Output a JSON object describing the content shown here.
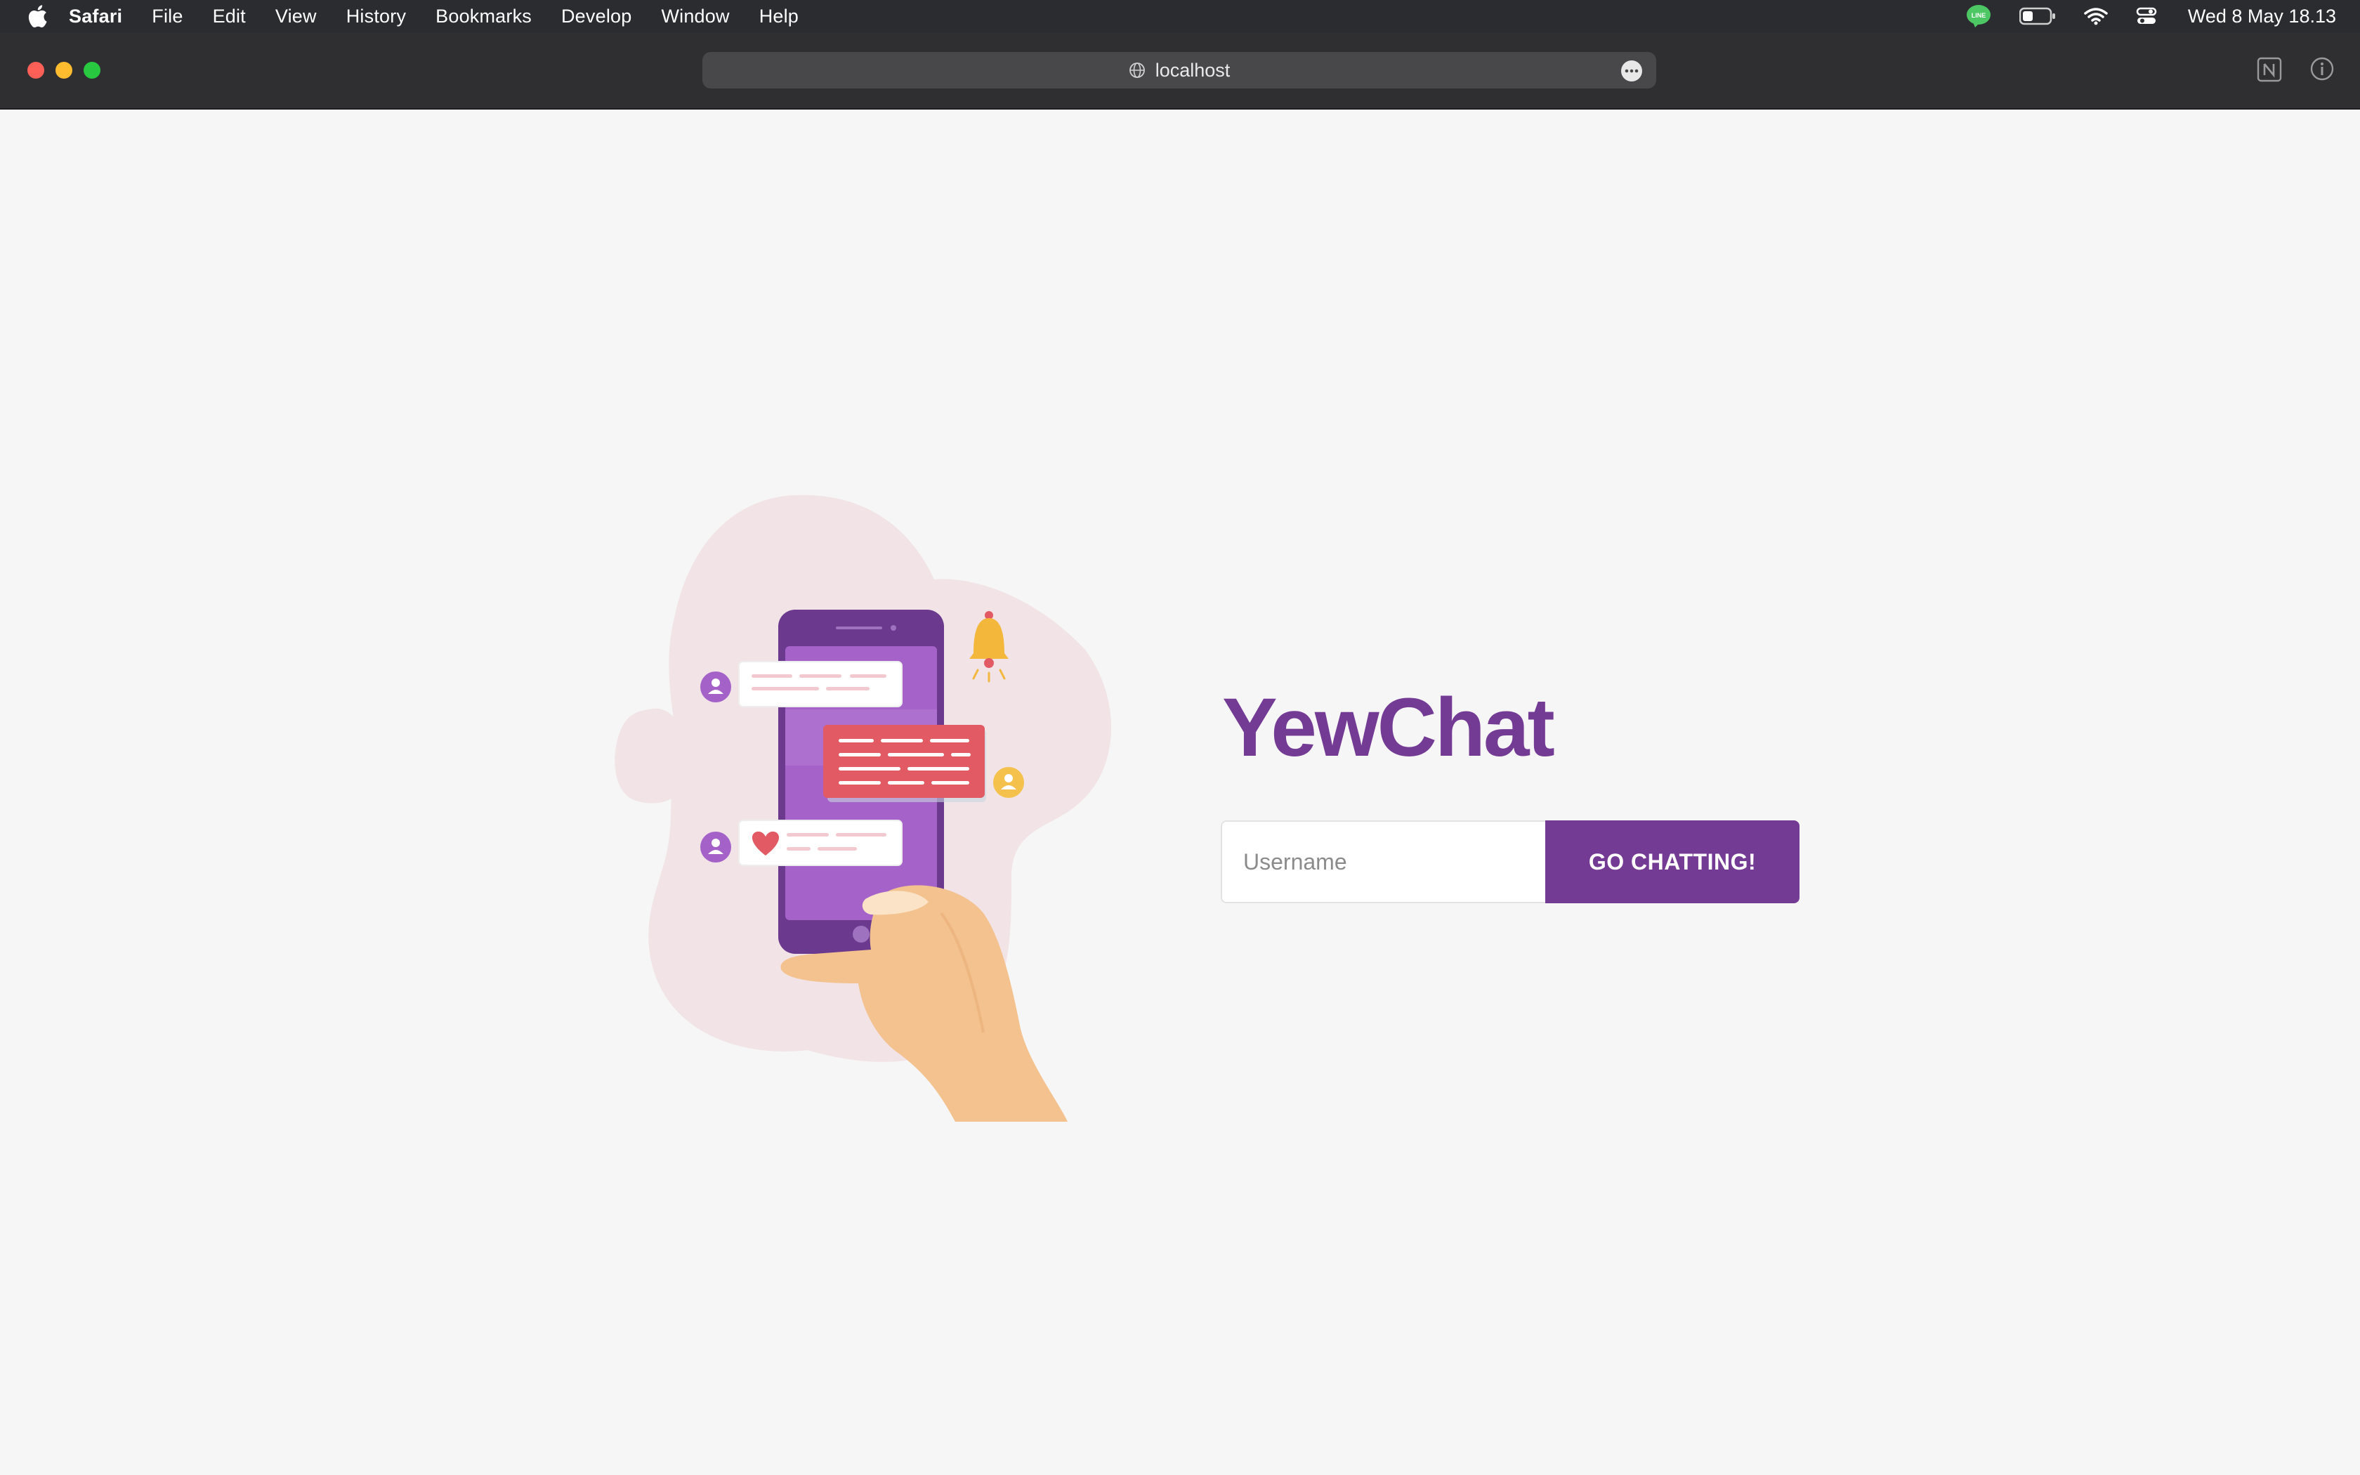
{
  "menubar": {
    "app_name": "Safari",
    "items": [
      "File",
      "Edit",
      "View",
      "History",
      "Bookmarks",
      "Develop",
      "Window",
      "Help"
    ],
    "clock": "Wed 8 May  18.13",
    "status_icons": [
      "line-app-icon",
      "battery-icon",
      "wifi-icon",
      "control-center-icon"
    ]
  },
  "browser": {
    "url": "localhost",
    "toolbar_icons": [
      "notion-extension-icon",
      "info-icon"
    ]
  },
  "page": {
    "title": "YewChat",
    "username_placeholder": "Username",
    "username_value": "",
    "button_label": "GO CHATTING!"
  },
  "colors": {
    "brand": "#743b94",
    "background": "#f6f6f6",
    "chat_bubble_red": "#e25a63",
    "bell": "#f3b73c"
  }
}
